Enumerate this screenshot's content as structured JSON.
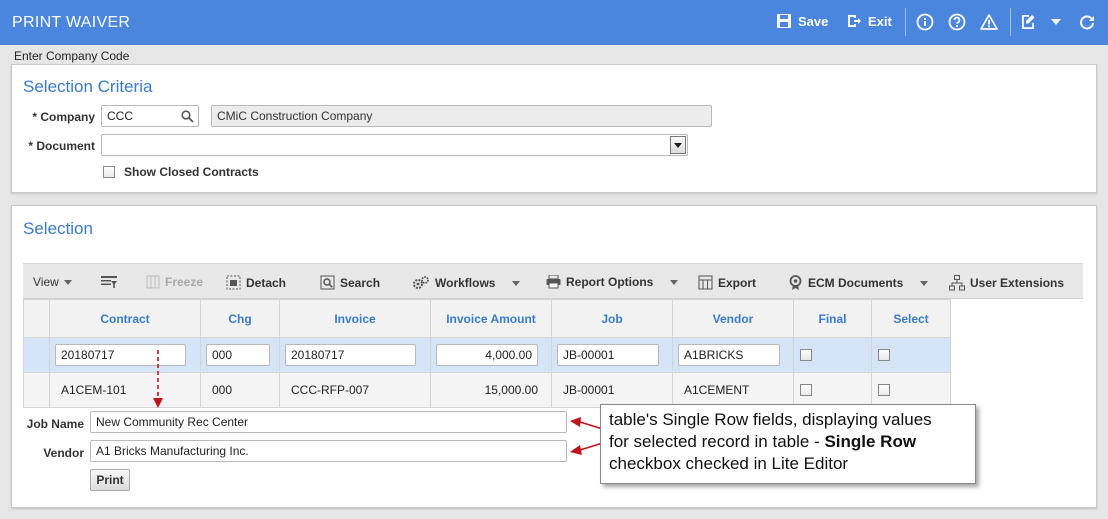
{
  "app": {
    "title": "PRINT WAIVER",
    "save_label": "Save",
    "exit_label": "Exit",
    "icons": [
      "save-icon",
      "exit-icon",
      "info-icon",
      "help-icon",
      "warning-icon",
      "edit-icon",
      "dropdown-icon",
      "refresh-icon"
    ]
  },
  "breadcrumb": "Enter Company Code",
  "criteria": {
    "title": "Selection Criteria",
    "company_label": "* Company",
    "company_value": "CCC",
    "company_name": "CMiC Construction Company",
    "document_label": "* Document",
    "document_value": "",
    "show_closed_label": "Show Closed Contracts"
  },
  "selection": {
    "title": "Selection",
    "toolbar": {
      "view": "View",
      "freeze": "Freeze",
      "detach": "Detach",
      "search": "Search",
      "workflows": "Workflows",
      "report_options": "Report Options",
      "export": "Export",
      "ecm_documents": "ECM Documents",
      "user_extensions": "User Extensions"
    },
    "columns": [
      "Contract",
      "Chg",
      "Invoice",
      "Invoice Amount",
      "Job",
      "Vendor",
      "Final",
      "Select"
    ],
    "rows": [
      {
        "contract": "20180717",
        "chg": "000",
        "invoice": "20180717",
        "amount": "4,000.00",
        "job": "JB-00001",
        "vendor": "A1BRICKS"
      },
      {
        "contract": "A1CEM-101",
        "chg": "000",
        "invoice": "CCC-RFP-007",
        "amount": "15,000.00",
        "job": "JB-00001",
        "vendor": "A1CEMENT"
      }
    ],
    "job_name_label": "Job Name",
    "job_name_value": "New Community Rec Center",
    "vendor_label": "Vendor",
    "vendor_value": "A1 Bricks Manufacturing Inc.",
    "print_label": "Print"
  },
  "callout": {
    "line1": "table's Single Row fields, displaying values",
    "line2a": "for selected record in table - ",
    "line2b": "Single Row",
    "line3": "checkbox checked in Lite Editor"
  },
  "colors": {
    "titlebar": "#4a86dd",
    "accent": "#3a7ccc",
    "selected_row": "#d5e4f7",
    "annotation": "#c0141a"
  }
}
